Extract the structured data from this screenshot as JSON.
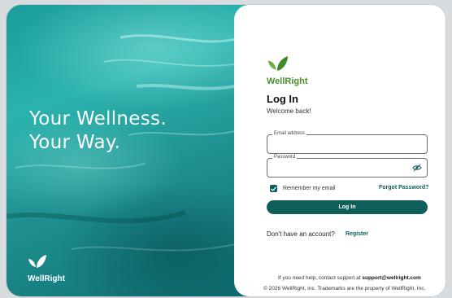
{
  "hero": {
    "tagline_line1": "Your Wellness.",
    "tagline_line2": "Your Way.",
    "brand": "WellRight",
    "logo_icon": "leaf-icon"
  },
  "card": {
    "brand": "WellRight",
    "logo_icon": "leaf-icon",
    "title": "Log In",
    "subtitle": "Welcome back!",
    "email": {
      "label": "Email address",
      "value": ""
    },
    "password": {
      "label": "Password",
      "value": "",
      "toggle_icon": "eye-off-icon"
    },
    "remember": {
      "label": "Remember my email",
      "checked": true
    },
    "forgot_label": "Forgot Password?",
    "login_label": "Log In",
    "no_account_text": "Don't have an account?",
    "register_label": "Register",
    "support_text": "If you need help, contact support at ",
    "support_email": "support@wellright.com",
    "copyright": "© 2026 WellRight, Inc. Trademarks are the property of WellRight, Inc."
  },
  "colors": {
    "accent": "#0e5f5a",
    "brand_green": "#4a8f2c",
    "hero_teal": "#1e9f9c"
  }
}
